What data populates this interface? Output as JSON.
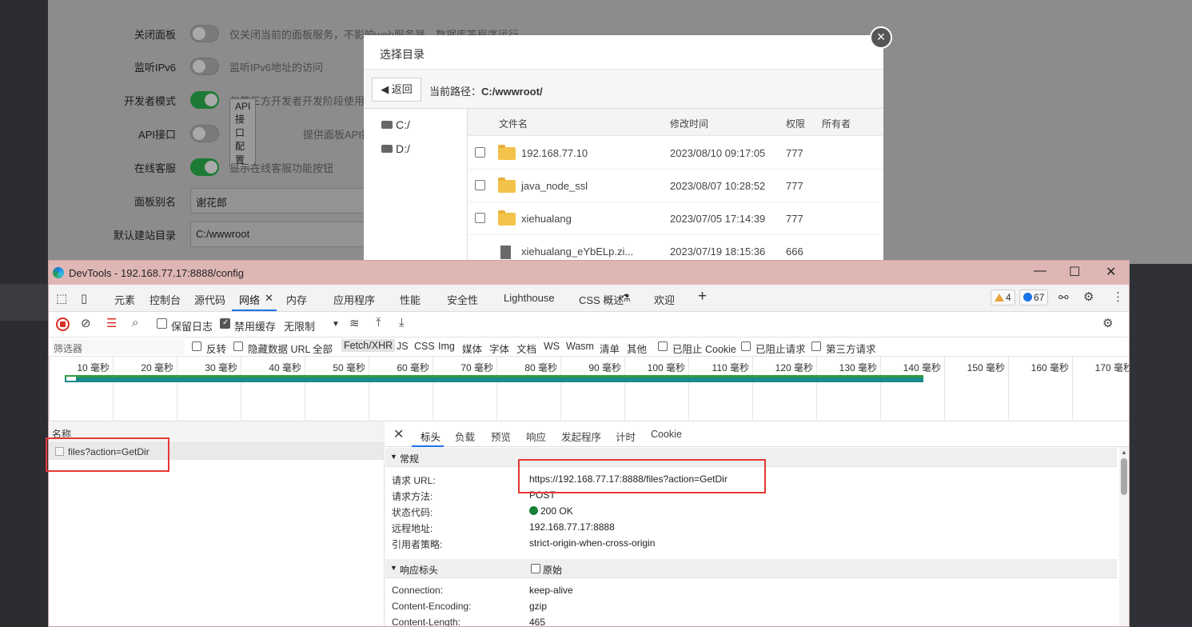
{
  "settings": [
    {
      "label": "关闭面板",
      "toggle": false,
      "desc": "仅关闭当前的面板服务，不影响web服务器、数据库等程序运行"
    },
    {
      "label": "监听IPv6",
      "toggle": false,
      "desc": "监听IPv6地址的访问"
    },
    {
      "label": "开发者模式",
      "toggle": true,
      "desc": "仅第三方开发者开发阶段使用（"
    },
    {
      "label": "API接口",
      "toggle": false,
      "button": "API接口配置",
      "desc": "提供面板API接"
    },
    {
      "label": "在线客服",
      "toggle": true,
      "desc": "显示在线客服功能按钮"
    },
    {
      "label": "面板别名",
      "value": "谢花郎"
    },
    {
      "label": "默认建站目录",
      "value": "C:/wwwroot"
    }
  ],
  "dialog": {
    "title": "选择目录",
    "back_label": "返回",
    "current_path_label": "当前路径：",
    "current_path": "C:/wwwroot/",
    "drives": [
      "C:/",
      "D:/"
    ],
    "columns": {
      "name": "文件名",
      "mtime": "修改时间",
      "perm": "权限",
      "owner": "所有者"
    },
    "rows": [
      {
        "type": "folder",
        "name": "192.168.77.10",
        "mtime": "2023/08/10 09:17:05",
        "perm": "777"
      },
      {
        "type": "folder",
        "name": "java_node_ssl",
        "mtime": "2023/08/07 10:28:52",
        "perm": "777"
      },
      {
        "type": "folder",
        "name": "xiehualang",
        "mtime": "2023/07/05 17:14:39",
        "perm": "777"
      },
      {
        "type": "file",
        "name": "xiehualang_eYbELp.zi...",
        "mtime": "2023/07/19 18:15:36",
        "perm": "666"
      }
    ]
  },
  "devtools": {
    "title": "DevTools - 192.168.77.17:8888/config",
    "tabs": [
      "元素",
      "控制台",
      "源代码",
      "网络",
      "内存",
      "应用程序",
      "性能",
      "安全性",
      "Lighthouse",
      "CSS 概述",
      "欢迎"
    ],
    "warnings": "4",
    "messages": "67",
    "toolbar": {
      "preserve_log": "保留日志",
      "disable_cache": "禁用缓存",
      "throttle": "无限制"
    },
    "filter": {
      "placeholder": "筛选器",
      "invert": "反转",
      "hide_data_url": "隐藏数据 URL",
      "types": [
        "全部",
        "Fetch/XHR",
        "JS",
        "CSS",
        "Img",
        "媒体",
        "字体",
        "文档",
        "WS",
        "Wasm",
        "清单",
        "其他"
      ],
      "blocked_cookies": "已阻止 Cookie",
      "blocked_requests": "已阻止请求",
      "third_party": "第三方请求"
    },
    "timeline_ticks": [
      "10 毫秒",
      "20 毫秒",
      "30 毫秒",
      "40 毫秒",
      "50 毫秒",
      "60 毫秒",
      "70 毫秒",
      "80 毫秒",
      "90 毫秒",
      "100 毫秒",
      "110 毫秒",
      "120 毫秒",
      "130 毫秒",
      "140 毫秒",
      "150 毫秒",
      "160 毫秒",
      "170 毫秒"
    ],
    "names_header": "名称",
    "request_name": "files?action=GetDir",
    "detail_tabs": [
      "标头",
      "负载",
      "预览",
      "响应",
      "发起程序",
      "计时",
      "Cookie"
    ],
    "general_title": "常规",
    "general": [
      {
        "k": "请求 URL:",
        "v": "https://192.168.77.17:8888/files?action=GetDir"
      },
      {
        "k": "请求方法:",
        "v": "POST"
      },
      {
        "k": "状态代码:",
        "v": "200 OK"
      },
      {
        "k": "远程地址:",
        "v": "192.168.77.17:8888"
      },
      {
        "k": "引用者策略:",
        "v": "strict-origin-when-cross-origin"
      }
    ],
    "response_title": "响应标头",
    "raw_label": "原始",
    "response": [
      {
        "k": "Connection:",
        "v": "keep-alive"
      },
      {
        "k": "Content-Encoding:",
        "v": "gzip"
      },
      {
        "k": "Content-Length:",
        "v": "465"
      }
    ]
  }
}
